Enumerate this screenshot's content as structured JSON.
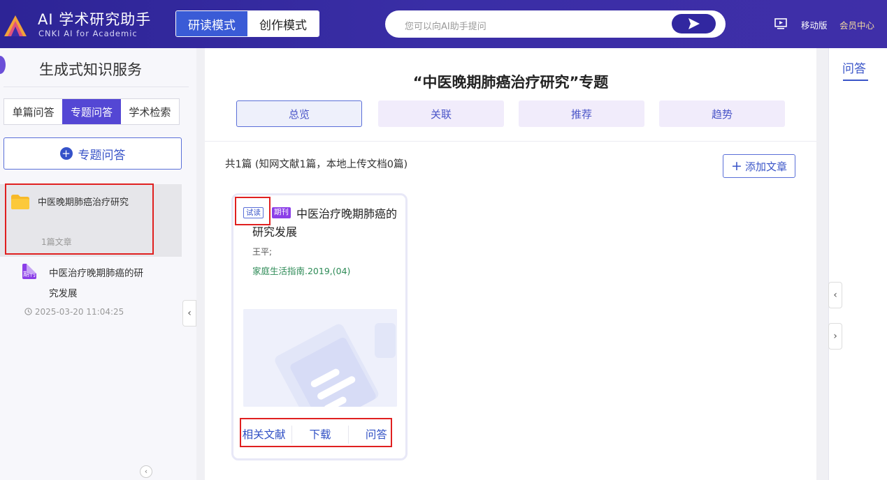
{
  "header": {
    "app_title": "AI 学术研究助手",
    "app_subtitle": "CNKI AI for Academic",
    "modes": [
      {
        "label": "研读模式",
        "active": true
      },
      {
        "label": "创作模式",
        "active": false
      }
    ],
    "search_placeholder": "您可以向AI助手提问",
    "mobile_label": "移动版",
    "member_label": "会员中心"
  },
  "sidebar": {
    "title": "生成式知识服务",
    "tabs": [
      {
        "label": "单篇问答",
        "active": false
      },
      {
        "label": "专题问答",
        "active": true
      },
      {
        "label": "学术检索",
        "active": false
      }
    ],
    "add_button_label": "专题问答",
    "topic": {
      "name": "中医晚期肺癌治疗研究",
      "count": "1篇文章"
    },
    "document": {
      "badge": "期刊",
      "title": "中医治疗晚期肺癌的研究发展",
      "time": "2025-03-20 11:04:25"
    }
  },
  "main": {
    "title": "“中医晚期肺癌治疗研究”专题",
    "view_tabs": [
      {
        "label": "总览",
        "active": true
      },
      {
        "label": "关联",
        "active": false
      },
      {
        "label": "推荐",
        "active": false
      },
      {
        "label": "趋势",
        "active": false
      }
    ],
    "summary": "共1篇 (知网文献1篇，本地上传文档0篇)",
    "add_article_label": "添加文章",
    "card": {
      "trial_tag": "试读",
      "journal_tag": "期刊",
      "title": "中医治疗晚期肺癌的研究发展",
      "author": "王平;",
      "source": "家庭生活指南.2019,(04)",
      "actions": [
        "相关文献",
        "下载",
        "问答"
      ]
    }
  },
  "right_panel": {
    "tab_label": "问答"
  },
  "colors": {
    "header_bg": "#3a2ea6",
    "accent": "#3a55c8",
    "highlight_red": "#e02020",
    "journal_purple": "#8b3ee8"
  }
}
